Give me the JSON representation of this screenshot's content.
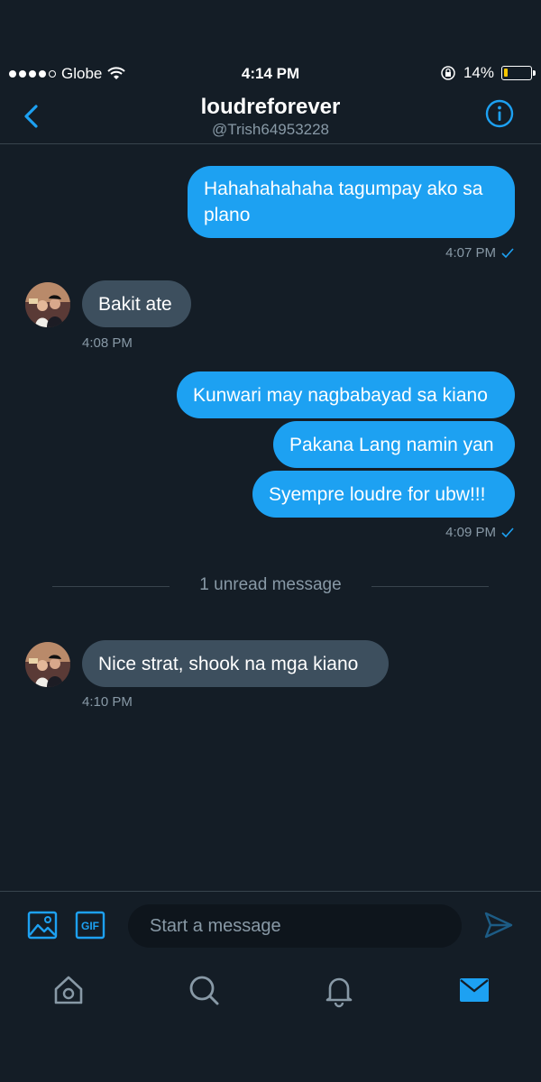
{
  "status_bar": {
    "carrier": "Globe",
    "time": "4:14 PM",
    "battery_percent": "14%",
    "battery_level": 0.14,
    "battery_color": "#f7c600",
    "icons": [
      "signal-dots",
      "wifi-icon",
      "orientation-lock-icon",
      "battery-icon"
    ]
  },
  "header": {
    "title": "loudreforever",
    "handle": "@Trish64953228",
    "back_icon": "chevron-left-icon",
    "info_icon": "info-icon"
  },
  "messages": [
    {
      "side": "sent",
      "lines": [
        "Hahahahahaha tagumpay ako sa",
        "plano"
      ],
      "time": "4:07 PM"
    },
    {
      "side": "received",
      "text": "Bakit ate",
      "time": "4:08 PM"
    },
    {
      "side": "sent",
      "text": "Kunwari may nagbabayad sa kiano"
    },
    {
      "side": "sent",
      "text": "Pakana Lang namin yan"
    },
    {
      "side": "sent",
      "text": "Syempre loudre for ubw!!!",
      "time": "4:09 PM"
    },
    {
      "side": "received",
      "text": "Nice strat, shook na mga kiano",
      "time": "4:10 PM"
    }
  ],
  "divider": {
    "label": "1 unread message"
  },
  "composer": {
    "placeholder": "Start a message",
    "image_icon": "image-icon",
    "gif_icon": "gif-icon",
    "gif_label": "GIF",
    "send_icon": "send-icon"
  },
  "tab_bar": {
    "tabs": [
      "home-icon",
      "search-icon",
      "notifications-icon",
      "messages-icon"
    ],
    "active": "messages-icon"
  },
  "colors": {
    "background": "#141d26",
    "accent": "#1da1f2",
    "received_bubble": "#3d4f5e",
    "muted_text": "#8899a6"
  }
}
